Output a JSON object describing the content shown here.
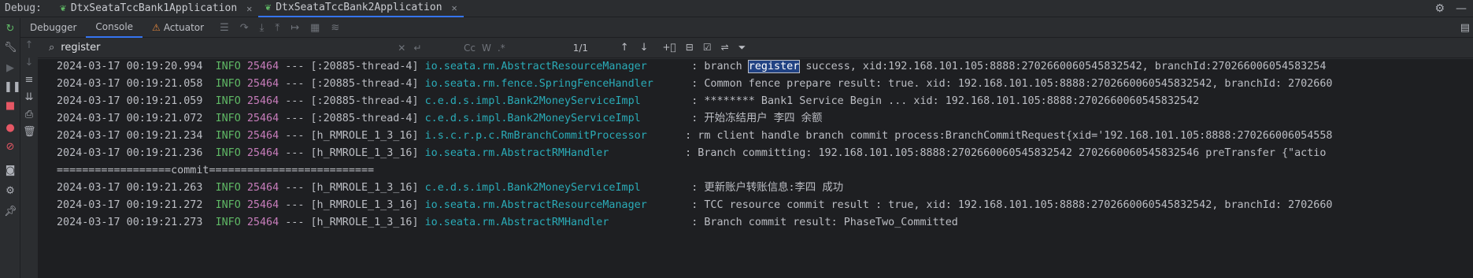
{
  "debugbar": {
    "title": "Debug:",
    "tabs": [
      {
        "label": "DtxSeataTccBank1Application",
        "active": false
      },
      {
        "label": "DtxSeataTccBank2Application",
        "active": true
      }
    ]
  },
  "panel_tabs": [
    {
      "label": "Debugger",
      "active": false
    },
    {
      "label": "Console",
      "active": true
    },
    {
      "label": "Actuator",
      "active": false
    }
  ],
  "search": {
    "value": "register",
    "match_count": "1/1",
    "case_label": "Cc",
    "word_label": "W",
    "regex_label": ".*"
  },
  "log": {
    "lines": [
      {
        "time": "2024-03-17 00:19:20.994",
        "level": "INFO",
        "pid": "25464",
        "thread": "--- [:20885-thread-4]",
        "logger": "io.seata.rm.AbstractResourceManager",
        "msg_before": ": branch ",
        "msg_highlight": "register",
        "msg_after": " success, xid:192.168.101.105:8888:2702660060545832542, branchId:270266006054583254"
      },
      {
        "time": "2024-03-17 00:19:21.058",
        "level": "INFO",
        "pid": "25464",
        "thread": "--- [:20885-thread-4]",
        "logger": "io.seata.rm.fence.SpringFenceHandler",
        "msg": ": Common fence prepare result: true. xid: 192.168.101.105:8888:2702660060545832542, branchId: 2702660"
      },
      {
        "time": "2024-03-17 00:19:21.059",
        "level": "INFO",
        "pid": "25464",
        "thread": "--- [:20885-thread-4]",
        "logger": "c.e.d.s.impl.Bank2MoneyServiceImpl",
        "msg": ": ******** Bank1 Service Begin ... xid: 192.168.101.105:8888:2702660060545832542"
      },
      {
        "time": "2024-03-17 00:19:21.072",
        "level": "INFO",
        "pid": "25464",
        "thread": "--- [:20885-thread-4]",
        "logger": "c.e.d.s.impl.Bank2MoneyServiceImpl",
        "msg": ": 开始冻结用户 李四 余额"
      },
      {
        "time": "2024-03-17 00:19:21.234",
        "level": "INFO",
        "pid": "25464",
        "thread": "--- [h_RMROLE_1_3_16]",
        "logger": "i.s.c.r.p.c.RmBranchCommitProcessor",
        "msg": ": rm client handle branch commit process:BranchCommitRequest{xid='192.168.101.105:8888:270266006054558"
      },
      {
        "time": "2024-03-17 00:19:21.236",
        "level": "INFO",
        "pid": "25464",
        "thread": "--- [h_RMROLE_1_3_16]",
        "logger": "io.seata.rm.AbstractRMHandler",
        "msg": ": Branch committing: 192.168.101.105:8888:2702660060545832542 2702660060545832546 preTransfer {\"actio"
      },
      {
        "plain": "==================commit=========================="
      },
      {
        "time": "2024-03-17 00:19:21.263",
        "level": "INFO",
        "pid": "25464",
        "thread": "--- [h_RMROLE_1_3_16]",
        "logger": "c.e.d.s.impl.Bank2MoneyServiceImpl",
        "msg": ": 更新账户转账信息:李四 成功"
      },
      {
        "time": "2024-03-17 00:19:21.272",
        "level": "INFO",
        "pid": "25464",
        "thread": "--- [h_RMROLE_1_3_16]",
        "logger": "io.seata.rm.AbstractResourceManager",
        "msg": ": TCC resource commit result : true, xid: 192.168.101.105:8888:2702660060545832542, branchId: 2702660"
      },
      {
        "time": "2024-03-17 00:19:21.273",
        "level": "INFO",
        "pid": "25464",
        "thread": "--- [h_RMROLE_1_3_16]",
        "logger": "io.seata.rm.AbstractRMHandler",
        "msg": ": Branch commit result: PhaseTwo_Committed"
      }
    ]
  },
  "colors": {
    "accent": "#3574f0",
    "info": "#5fb865",
    "pid": "#c77dbb",
    "logger": "#2aacb8",
    "highlight": "#214283"
  }
}
